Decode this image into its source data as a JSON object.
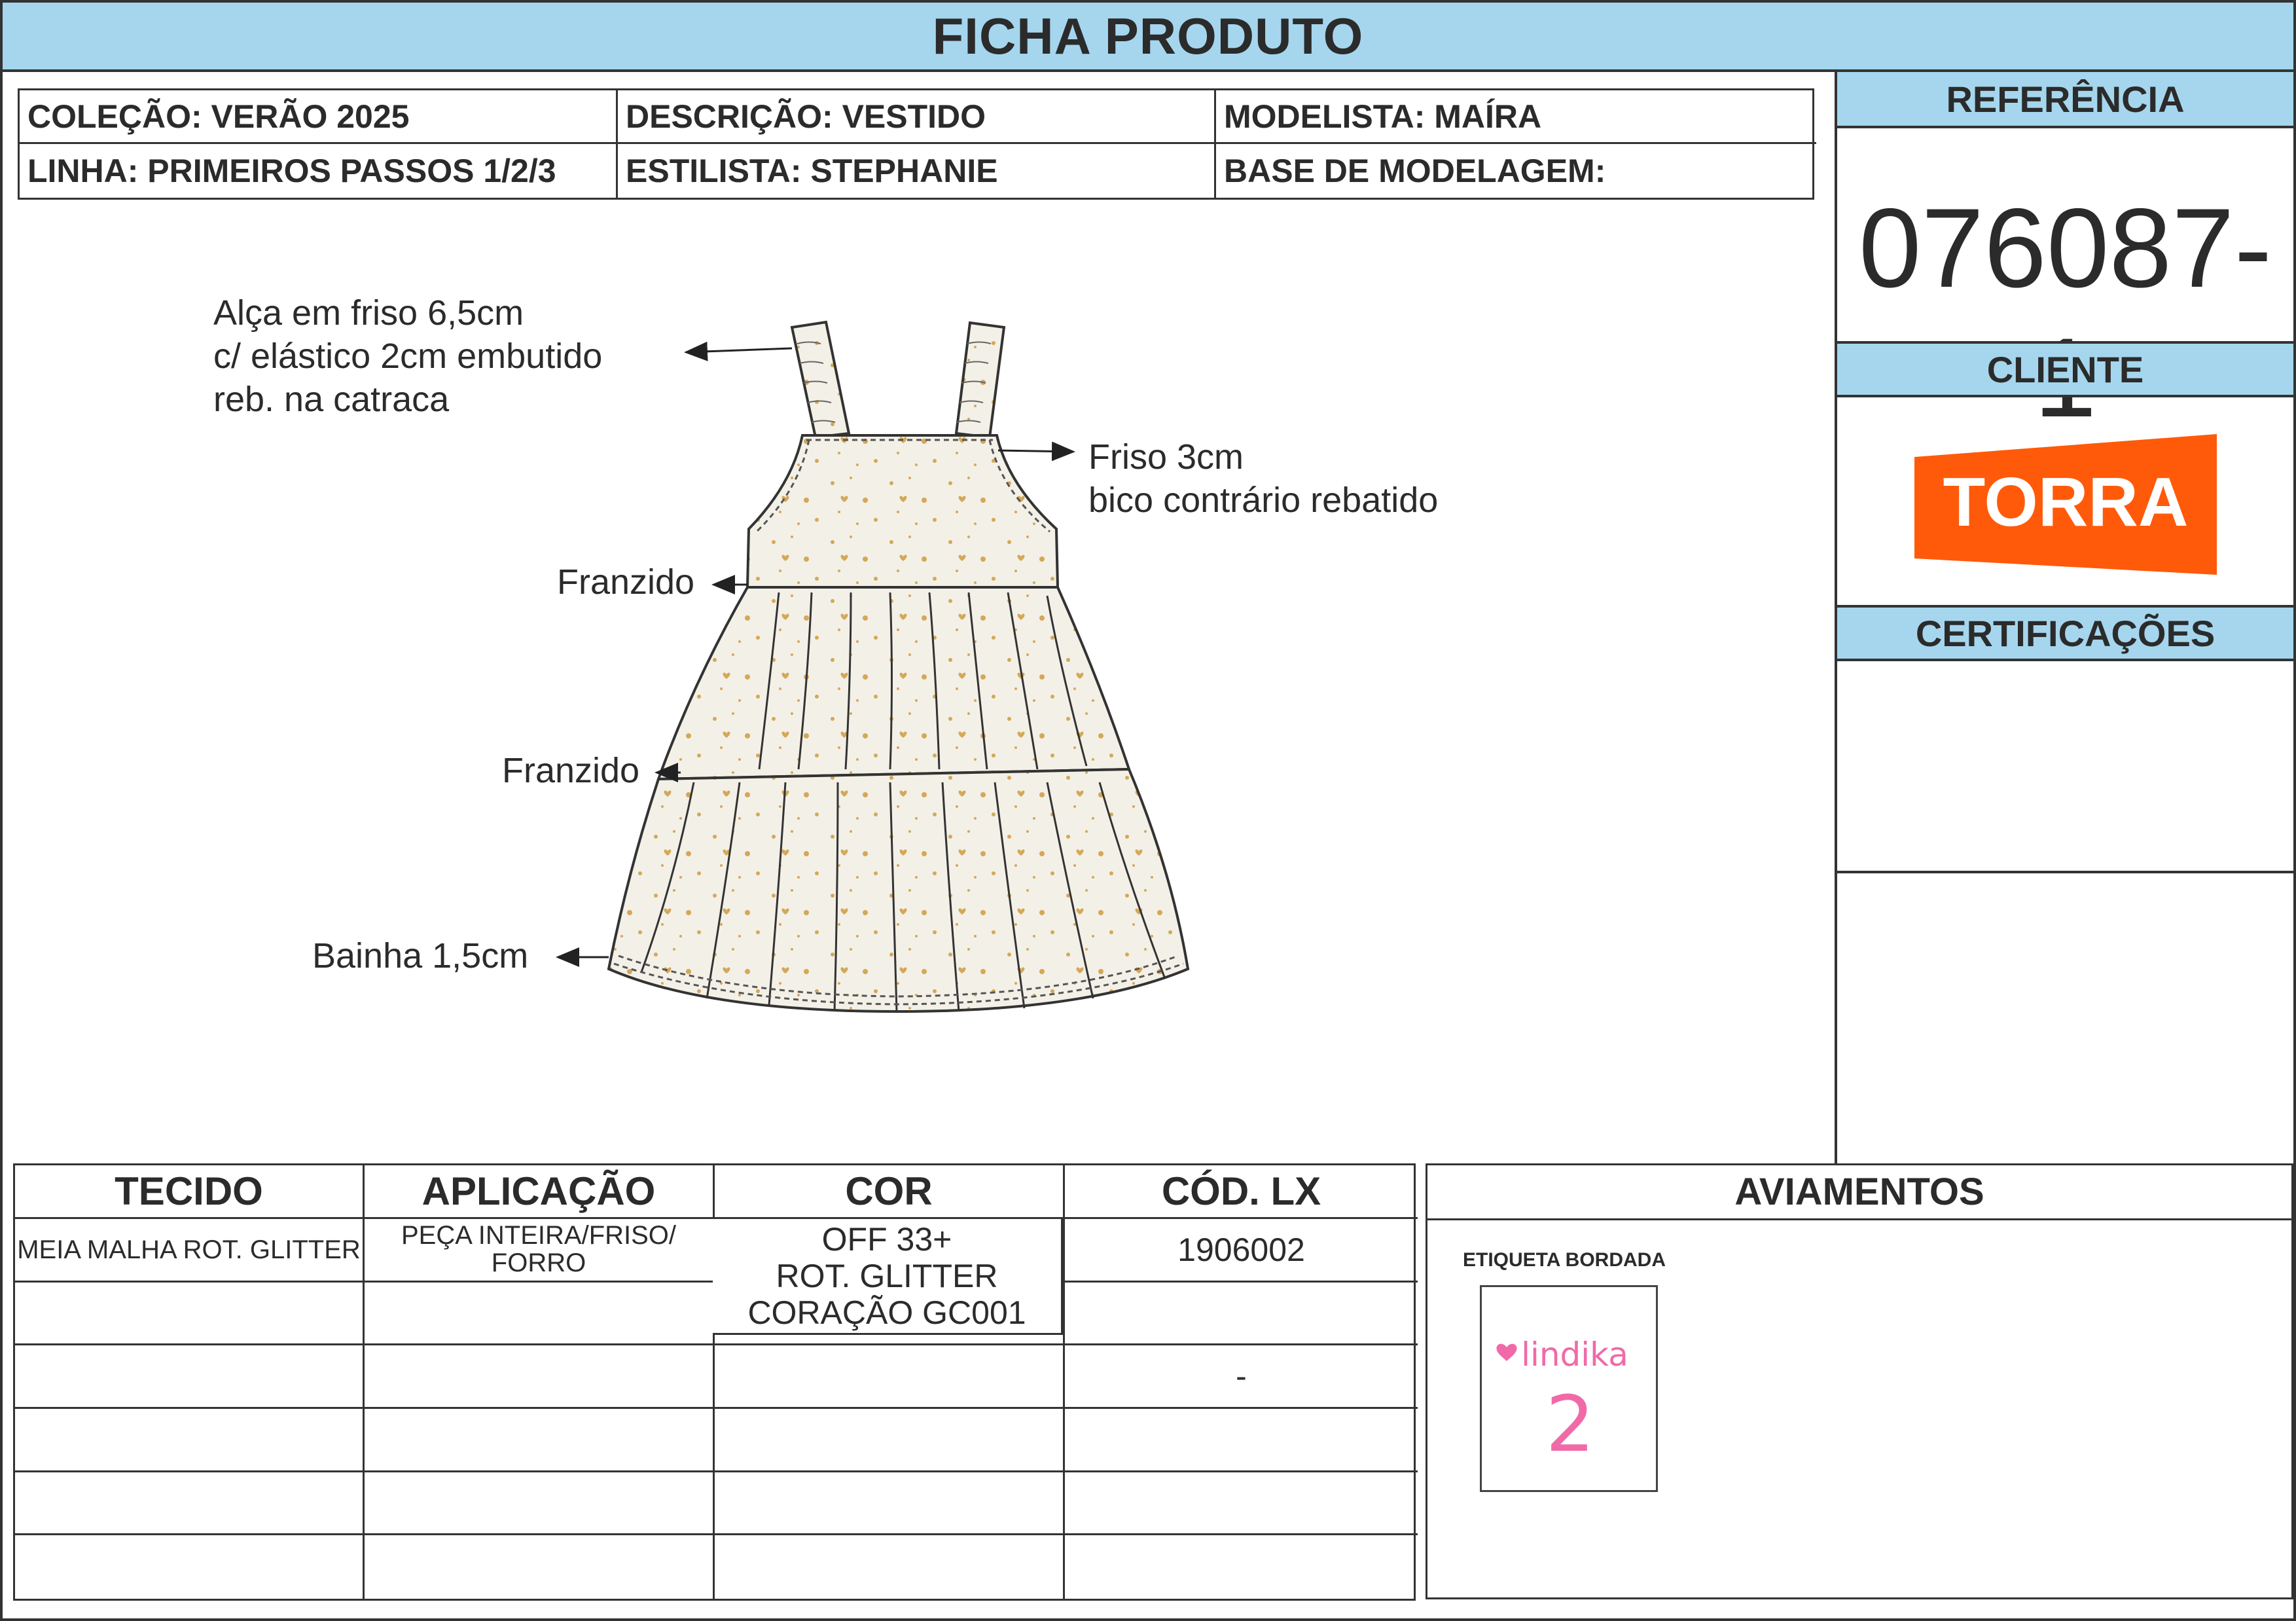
{
  "header": {
    "title": "FICHA PRODUTO"
  },
  "info": {
    "colecao": "COLEÇÃO: VERÃO 2025",
    "descricao": "DESCRIÇÃO: VESTIDO",
    "modelista": "MODELISTA: MAÍRA",
    "linha": "LINHA: PRIMEIROS PASSOS 1/2/3",
    "estilista": "ESTILISTA: STEPHANIE",
    "base": "BASE DE MODELAGEM:"
  },
  "sidebar": {
    "referencia_label": "REFERÊNCIA",
    "referencia_value": "076087-1",
    "cliente_label": "CLIENTE",
    "cliente_logo_text": "TORRA",
    "certificacoes_label": "CERTIFICAÇÕES"
  },
  "annotations": {
    "alca": [
      "Alça em friso 6,5cm",
      "c/ elástico 2cm embutido",
      "reb. na catraca"
    ],
    "friso": [
      "Friso 3cm",
      "bico contrário rebatido"
    ],
    "franzido_1": "Franzido",
    "franzido_2": "Franzido",
    "bainha": "Bainha 1,5cm"
  },
  "fabric_table": {
    "headers": [
      "TECIDO",
      "APLICAÇÃO",
      "COR",
      "CÓD. LX"
    ],
    "rows": [
      [
        "MEIA MALHA ROT. GLITTER",
        "PEÇA INTEIRA/FRISO/\nFORRO",
        "",
        "1906002"
      ],
      [
        "",
        "",
        "",
        ""
      ],
      [
        "",
        "",
        "",
        "-"
      ],
      [
        "",
        "",
        "",
        ""
      ],
      [
        "",
        "",
        "",
        ""
      ],
      [
        "",
        "",
        "",
        ""
      ]
    ],
    "cor_lines": [
      "OFF 33+",
      "ROT. GLITTER",
      "CORAÇÃO GC001"
    ]
  },
  "aviamentos": {
    "title": "AVIAMENTOS",
    "item_label": "ETIQUETA BORDADA",
    "label_brand": "lindika",
    "label_size": "2"
  },
  "colors": {
    "header_blue": "#a5d6ee",
    "torra_orange": "#ff5a0a",
    "label_pink": "#f06aa8",
    "dress_fabric": "#f2efe6",
    "glitter": "#d4a857"
  }
}
